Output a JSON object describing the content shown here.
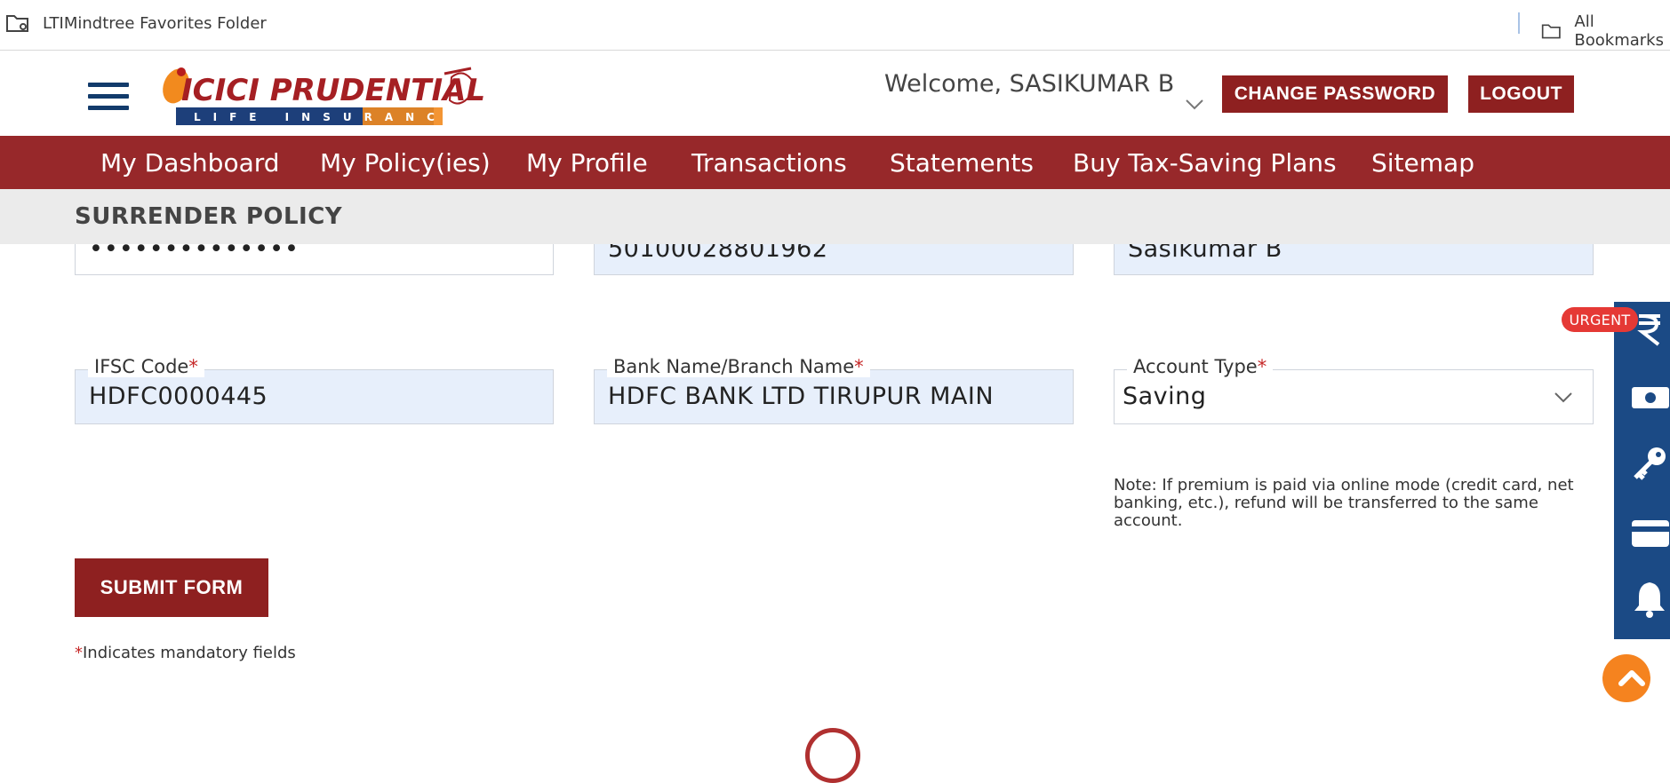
{
  "bookmarks": {
    "left_label": "LTIMindtree Favorites Folder",
    "right_label": "All Bookmarks"
  },
  "header": {
    "logo_text": "ICICI PRUDENTIAL",
    "logo_subtext": "LIFE INSURANCE",
    "welcome": "Welcome, SASIKUMAR B",
    "change_password": "CHANGE PASSWORD",
    "logout": "LOGOUT"
  },
  "nav": {
    "items": [
      "My Dashboard",
      "My Policy(ies)",
      "My Profile",
      "Transactions",
      "Statements",
      "Buy Tax-Saving Plans",
      "Sitemap"
    ]
  },
  "page": {
    "title": "SURRENDER POLICY"
  },
  "form": {
    "account_number_masked": "••••••••••••••",
    "account_number_confirm": "50100028801962",
    "account_holder": "Sasikumar B",
    "ifsc_label": "IFSC Code",
    "ifsc_value": "HDFC0000445",
    "bank_label": "Bank Name/Branch Name",
    "bank_value": "HDFC BANK LTD TIRUPUR MAIN",
    "account_type_label": "Account Type",
    "account_type_value": "Saving",
    "required_mark": "*",
    "note": "Note: If premium is paid via online mode (credit card, net banking, etc.), refund will be transferred to the same account.",
    "submit": "SUBMIT FORM",
    "mandatory_text": "Indicates mandatory fields"
  },
  "rail": {
    "urgent_badge": "URGENT",
    "icons": [
      "rupee-icon",
      "cash-icon",
      "key-icon",
      "card-icon",
      "bell-icon"
    ]
  },
  "colors": {
    "brand_red": "#97282a",
    "button_red": "#8e2020",
    "rail_blue": "#1b4a85",
    "field_fill": "#e7effb",
    "scroll_orange": "#f5831f",
    "urgent_red": "#e53935"
  }
}
